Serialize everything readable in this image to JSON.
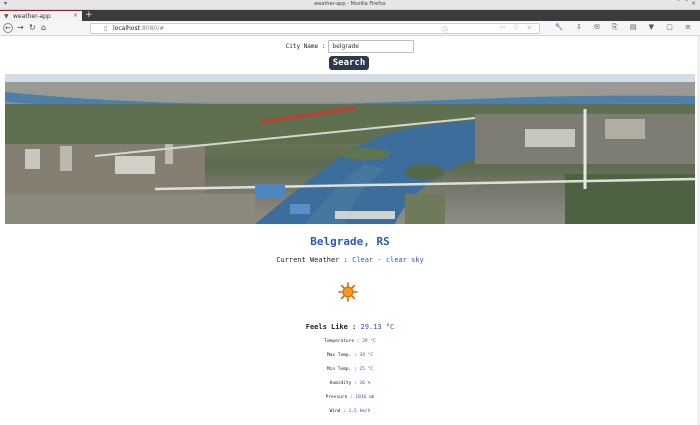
{
  "window": {
    "title": "weather-app - Mozilla Firefox"
  },
  "tab": {
    "label": "weather-app"
  },
  "urlbar": {
    "host": "localhost",
    "rest": ":8080/#"
  },
  "form": {
    "label": "City Name :",
    "value": "belgrade",
    "button": "Search"
  },
  "weather": {
    "city": "Belgrade, RS",
    "current_label": "Current Weather :",
    "current_value": "Clear - clear sky",
    "feels_label": "Feels Like :",
    "feels_value": "29.13 °C",
    "rows": [
      {
        "label": "Temperature :",
        "value": "29 °C"
      },
      {
        "label": "Max Temp. :",
        "value": "34 °C"
      },
      {
        "label": "Min Temp. :",
        "value": "25 °C"
      },
      {
        "label": "Humidity :",
        "value": "36 %"
      },
      {
        "label": "Pressure :",
        "value": "1016 mb"
      },
      {
        "label": "Wind :",
        "value": "1.5 km/h"
      }
    ]
  },
  "colors": {
    "accent": "#2a56c6",
    "button": "#2d3a4a",
    "tab_accent": "#d70022"
  },
  "icons": [
    "sun-icon"
  ]
}
